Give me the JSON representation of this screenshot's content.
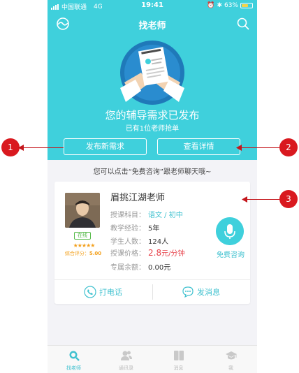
{
  "status_bar": {
    "carrier": "中国联通",
    "network": "4G",
    "time": "19:41",
    "battery": "63%",
    "battery_level": 0.63
  },
  "nav": {
    "title": "找老师",
    "left_icon": "logo-icon",
    "right_icon": "search-icon"
  },
  "hero": {
    "headline": "您的辅导需求已发布",
    "subline": "已有1位老师抢单",
    "btn_publish": "发布新需求",
    "btn_details": "查看详情"
  },
  "tip": "您可以点击“免费咨询”跟老师聊天哦~",
  "teacher": {
    "name": "眉挑江湖老师",
    "online": "在线",
    "stars": "★★★★★",
    "score_label": "综合评分：",
    "score": "5.00",
    "subject_label": "授课科目：",
    "subject": "语文 / 初中",
    "experience_label": "教学经验：",
    "experience": "5年",
    "students_label": "学生人数：",
    "students": "124人",
    "price_label": "授课价格：",
    "price": "2.8",
    "price_unit": "元/分钟",
    "balance_label": "专属余额：",
    "balance": "0.00元",
    "consult": "免费咨询",
    "call": "打电话",
    "message": "发消息"
  },
  "tabs": [
    {
      "label": "找老师",
      "icon": "search-icon",
      "active": true
    },
    {
      "label": "通讯录",
      "icon": "contacts-icon",
      "active": false
    },
    {
      "label": "消息",
      "icon": "book-icon",
      "active": false
    },
    {
      "label": "我",
      "icon": "graduation-cap-icon",
      "active": false
    }
  ],
  "callouts": [
    "1",
    "2",
    "3"
  ],
  "colors": {
    "accent": "#3fd0dc",
    "price": "#e7434b",
    "callout": "#d9191f",
    "star": "#f3a01c"
  }
}
